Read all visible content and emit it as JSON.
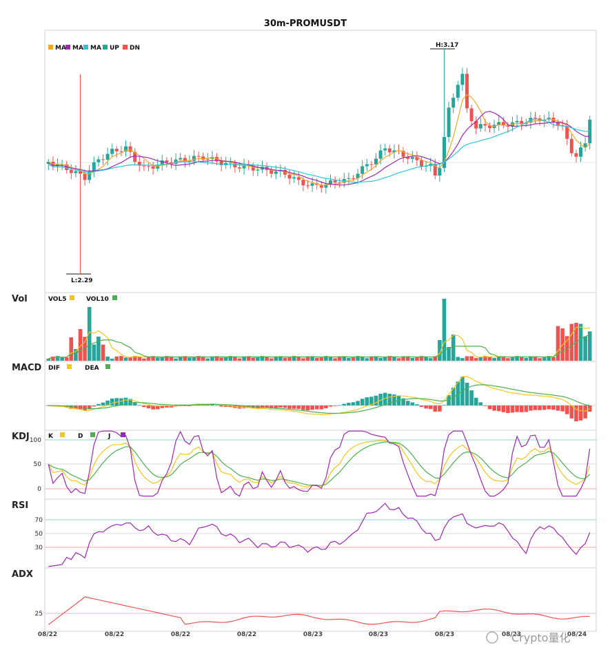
{
  "title": "30m-PROMUSDT",
  "watermark": "Crypto量化",
  "colors": {
    "up": "#26a69a",
    "down": "#ef5350",
    "ma1": "#f5a623",
    "ma2": "#9c27b0",
    "ma3": "#26c6da",
    "vol5": "#f5c518",
    "vol10": "#4caf50",
    "dif": "#f5c518",
    "dea": "#4caf50",
    "k": "#f5c518",
    "d": "#4caf50",
    "j": "#9c27b0",
    "rsi": "#9c27b0",
    "adx": "#ef5350"
  },
  "chart_data": {
    "type": "candlestick",
    "price": {
      "high_label": "H:3.17",
      "low_label": "L:2.29",
      "legend": [
        "MA",
        "MA",
        "MA",
        "UP",
        "DN"
      ]
    },
    "volume": {
      "label": "Vol",
      "legend": [
        "VOL5",
        "VOL10"
      ]
    },
    "macd": {
      "label": "MACD",
      "legend": [
        "DIF",
        "DEA"
      ]
    },
    "kdj": {
      "label": "KDJ",
      "legend": [
        "K",
        "D",
        "J"
      ],
      "yticks": [
        "100",
        "50",
        "0"
      ]
    },
    "rsi": {
      "label": "RSI",
      "yticks": [
        "70",
        "50",
        "30"
      ]
    },
    "adx": {
      "label": "ADX",
      "yticks": [
        "25"
      ]
    },
    "x_ticks": [
      "08/22",
      "08/22",
      "08/22",
      "08/22",
      "08/23",
      "08/23",
      "08/23",
      "08/23",
      "08/24"
    ]
  }
}
